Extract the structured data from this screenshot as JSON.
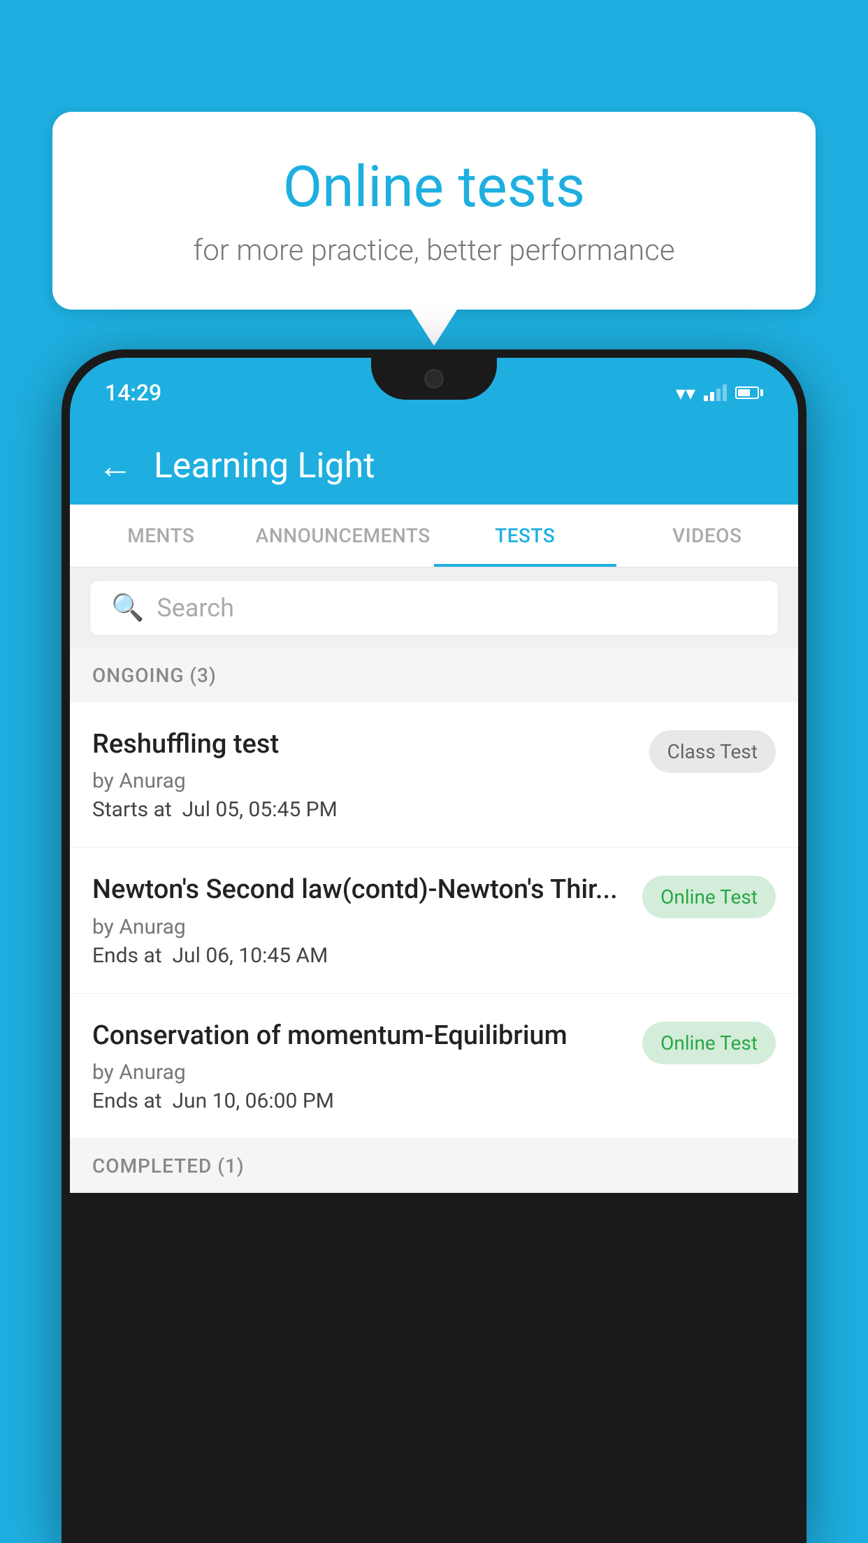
{
  "background_color": "#1EAFE0",
  "bubble": {
    "title": "Online tests",
    "subtitle": "for more practice, better performance"
  },
  "phone": {
    "status_bar": {
      "time": "14:29"
    },
    "app_bar": {
      "title": "Learning Light",
      "back_label": "←"
    },
    "tabs": [
      {
        "label": "MENTS",
        "active": false
      },
      {
        "label": "ANNOUNCEMENTS",
        "active": false
      },
      {
        "label": "TESTS",
        "active": true
      },
      {
        "label": "VIDEOS",
        "active": false
      }
    ],
    "search": {
      "placeholder": "Search"
    },
    "ongoing_section": {
      "label": "ONGOING (3)"
    },
    "tests": [
      {
        "title": "Reshuffling test",
        "author": "by Anurag",
        "date_label": "Starts at",
        "date": "Jul 05, 05:45 PM",
        "badge": "Class Test",
        "badge_type": "class"
      },
      {
        "title": "Newton's Second law(contd)-Newton's Thir...",
        "author": "by Anurag",
        "date_label": "Ends at",
        "date": "Jul 06, 10:45 AM",
        "badge": "Online Test",
        "badge_type": "online"
      },
      {
        "title": "Conservation of momentum-Equilibrium",
        "author": "by Anurag",
        "date_label": "Ends at",
        "date": "Jun 10, 06:00 PM",
        "badge": "Online Test",
        "badge_type": "online"
      }
    ],
    "completed_section": {
      "label": "COMPLETED (1)"
    }
  }
}
